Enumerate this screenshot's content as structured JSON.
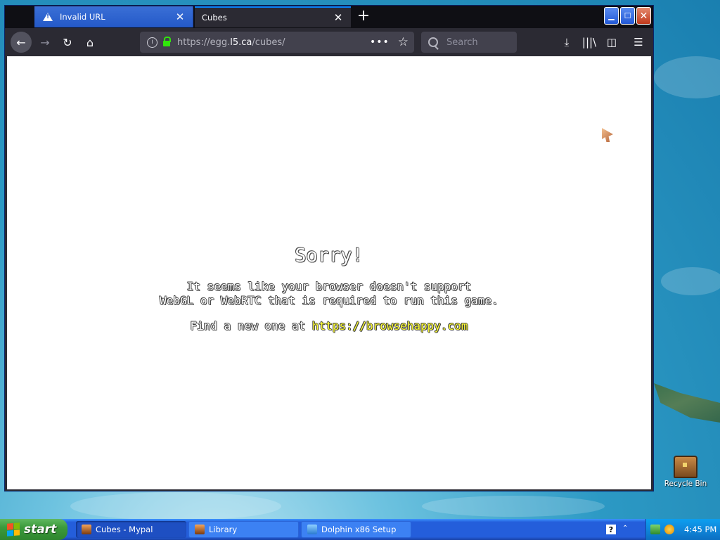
{
  "browser": {
    "tabs": [
      {
        "label": "Invalid URL",
        "active": false
      },
      {
        "label": "Cubes",
        "active": true
      }
    ],
    "url": {
      "domain_prefix": "https://egg.",
      "domain_main": "l5.ca",
      "path": "/cubes/"
    },
    "search": {
      "placeholder": "Search"
    }
  },
  "page": {
    "title": "Sorry!",
    "line1": "It seems like your browser doesn't support",
    "line2": "WebGL or WebRTC that is required to run this game.",
    "line3_prefix": "Find a new one at ",
    "link": "https://browsehappy.com"
  },
  "desktop": {
    "recycle_bin": "Recycle Bin"
  },
  "taskbar": {
    "start": "start",
    "items": [
      {
        "label": "Cubes - Mypal",
        "active": true
      },
      {
        "label": "Library",
        "active": false
      },
      {
        "label": "Dolphin x86 Setup",
        "active": false
      }
    ],
    "clock": "4:45 PM"
  }
}
